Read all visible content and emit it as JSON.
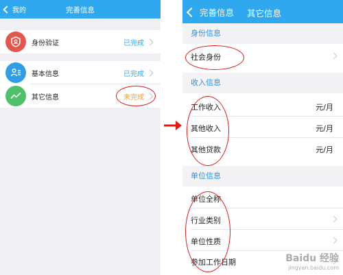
{
  "left": {
    "back_label": "我的",
    "title": "完善信息",
    "items": [
      {
        "label": "身份验证",
        "status": "已完成",
        "icon": "shield-icon",
        "icon_color": "#e4554d"
      },
      {
        "label": "基本信息",
        "status": "已完成",
        "icon": "person-card-icon",
        "icon_color": "#2f9ee8"
      },
      {
        "label": "其它信息",
        "status": "未完成",
        "icon": "trend-line-icon",
        "icon_color": "#4cc16a"
      }
    ]
  },
  "right": {
    "back_label": "完善信息",
    "title": "其它信息",
    "sections": [
      {
        "title": "身份信息",
        "rows": [
          {
            "label": "社会身份",
            "value": ""
          }
        ]
      },
      {
        "title": "收入信息",
        "rows": [
          {
            "label": "工作收入",
            "value": "元/月"
          },
          {
            "label": "其他收入",
            "value": "元/月"
          },
          {
            "label": "其他贷款",
            "value": "元/月"
          }
        ]
      },
      {
        "title": "单位信息",
        "rows": [
          {
            "label": "单位全称",
            "value": ""
          },
          {
            "label": "行业类别",
            "value": ""
          },
          {
            "label": "单位性质",
            "value": ""
          },
          {
            "label": "参加工作日期",
            "value": ""
          }
        ]
      }
    ]
  },
  "colors": {
    "accent": "#30a8f0",
    "done": "#30a8f0",
    "todo": "#e8a33a",
    "annotation": "#e01818"
  },
  "watermark": {
    "main": "Baidu 经验",
    "sub": "jingyan.baidu.com"
  }
}
